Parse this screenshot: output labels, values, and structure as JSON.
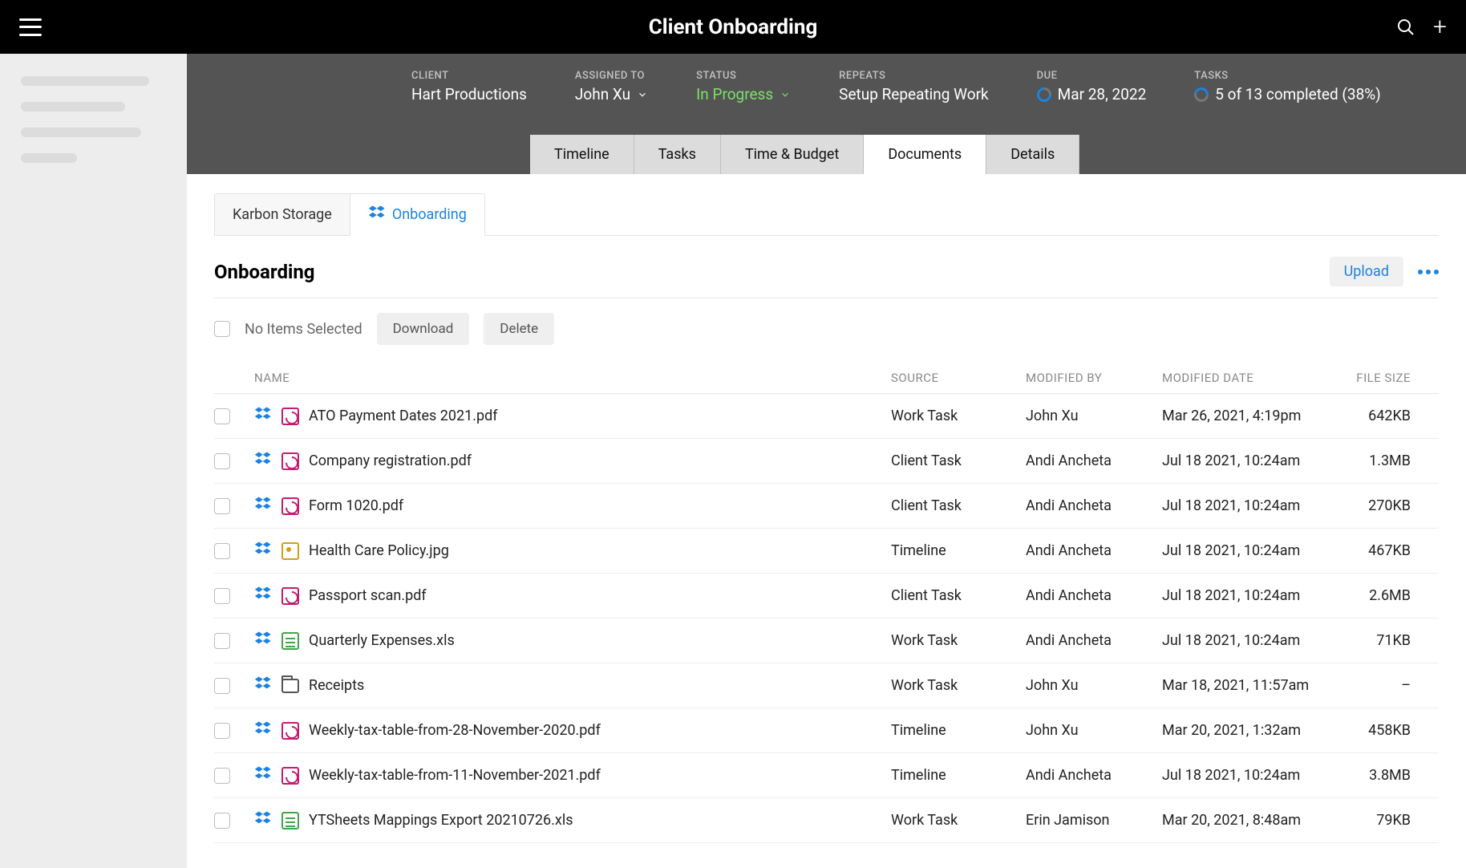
{
  "topbar": {
    "title": "Client Onboarding"
  },
  "work": {
    "client_label": "CLIENT",
    "client_value": "Hart Productions",
    "assigned_label": "ASSIGNED TO",
    "assigned_value": "John Xu",
    "status_label": "STATUS",
    "status_value": "In Progress",
    "repeats_label": "REPEATS",
    "repeats_value": "Setup Repeating Work",
    "due_label": "DUE",
    "due_value": "Mar 28, 2022",
    "tasks_label": "TASKS",
    "tasks_value": "5 of 13  completed (38%)"
  },
  "tabs": {
    "timeline": "Timeline",
    "tasks": "Tasks",
    "time_budget": "Time & Budget",
    "documents": "Documents",
    "details": "Details"
  },
  "subtabs": {
    "karbon": "Karbon Storage",
    "onboarding": "Onboarding"
  },
  "section": {
    "title": "Onboarding",
    "upload": "Upload",
    "selection": "No Items Selected",
    "download": "Download",
    "delete": "Delete"
  },
  "columns": {
    "name": "NAME",
    "source": "SOURCE",
    "modified_by": "MODIFIED BY",
    "modified_date": "MODIFIED DATE",
    "file_size": "FILE SIZE"
  },
  "files": [
    {
      "name": "ATO Payment Dates 2021.pdf",
      "type": "pdf",
      "source": "Work Task",
      "modified_by": "John Xu",
      "modified_date": "Mar 26, 2021, 4:19pm",
      "size": "642KB"
    },
    {
      "name": "Company registration.pdf",
      "type": "pdf",
      "source": "Client Task",
      "modified_by": "Andi Ancheta",
      "modified_date": "Jul 18 2021, 10:24am",
      "size": "1.3MB"
    },
    {
      "name": "Form 1020.pdf",
      "type": "pdf",
      "source": "Client Task",
      "modified_by": "Andi Ancheta",
      "modified_date": "Jul 18 2021, 10:24am",
      "size": "270KB"
    },
    {
      "name": "Health Care Policy.jpg",
      "type": "jpg",
      "source": "Timeline",
      "modified_by": "Andi Ancheta",
      "modified_date": "Jul 18 2021, 10:24am",
      "size": "467KB"
    },
    {
      "name": "Passport scan.pdf",
      "type": "pdf",
      "source": "Client Task",
      "modified_by": "Andi Ancheta",
      "modified_date": "Jul 18 2021, 10:24am",
      "size": "2.6MB"
    },
    {
      "name": "Quarterly Expenses.xls",
      "type": "xls",
      "source": "Work Task",
      "modified_by": "Andi Ancheta",
      "modified_date": "Jul 18 2021, 10:24am",
      "size": "71KB"
    },
    {
      "name": "Receipts",
      "type": "folder",
      "source": "Work Task",
      "modified_by": "John Xu",
      "modified_date": "Mar 18, 2021, 11:57am",
      "size": "–"
    },
    {
      "name": "Weekly-tax-table-from-28-November-2020.pdf",
      "type": "pdf",
      "source": "Timeline",
      "modified_by": "John Xu",
      "modified_date": "Mar 20, 2021, 1:32am",
      "size": "458KB"
    },
    {
      "name": "Weekly-tax-table-from-11-November-2021.pdf",
      "type": "pdf",
      "source": "Timeline",
      "modified_by": "Andi Ancheta",
      "modified_date": "Jul 18 2021, 10:24am",
      "size": "3.8MB"
    },
    {
      "name": "YTSheets Mappings Export 20210726.xls",
      "type": "xls",
      "source": "Work Task",
      "modified_by": "Erin Jamison",
      "modified_date": "Mar 20, 2021, 8:48am",
      "size": "79KB"
    }
  ]
}
